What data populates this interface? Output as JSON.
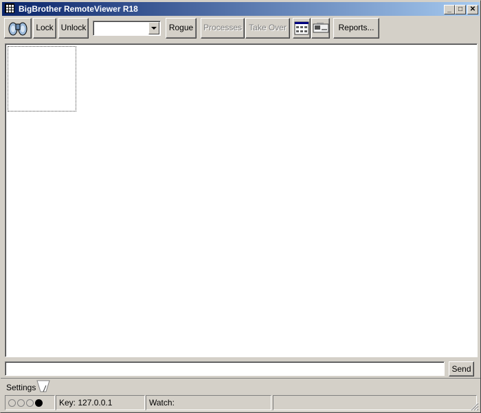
{
  "window": {
    "title": "BigBrother RemoteViewer R18"
  },
  "titlebar": {
    "minimize_glyph": "_",
    "maximize_glyph": "□",
    "close_glyph": "✕"
  },
  "toolbar": {
    "lock_label": "Lock",
    "unlock_label": "Unlock",
    "computer_select_value": "",
    "rogue_label": "Rogue",
    "processes_label": "Processes",
    "take_over_label": "Take Over",
    "reports_label": "Reports..."
  },
  "icons": {
    "app": "grid-icon",
    "binoculars": "binoculars-icon",
    "view_window": "window-icon",
    "screen_capture": "screen-icon"
  },
  "message": {
    "input_value": "",
    "send_label": "Send"
  },
  "settings": {
    "label": "Settings"
  },
  "status": {
    "indicators": [
      false,
      false,
      false,
      true
    ],
    "key": "Key: 127.0.0.1",
    "watch": "Watch:"
  },
  "colors": {
    "titlebar_start": "#0a246a",
    "titlebar_end": "#a6caf0",
    "face": "#d4d0c8"
  }
}
